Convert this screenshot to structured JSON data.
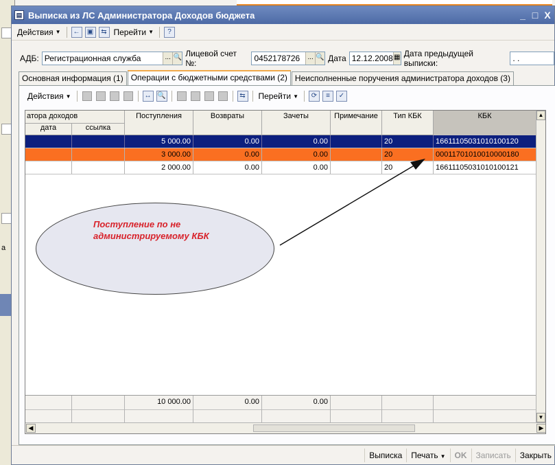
{
  "window": {
    "title": "Выписка из ЛС Администратора Доходов бюджета",
    "controls": {
      "minimize": "_",
      "maximize": "□",
      "close": "X"
    }
  },
  "toolbar": {
    "actions_label": "Действия",
    "goto_label": "Перейти",
    "help_label": "?"
  },
  "form": {
    "adb_label": "АДБ:",
    "adb_value": "Регистрационная служба",
    "account_label": "Лицевой счет №:",
    "account_value": "0452178726",
    "date_label": "Дата",
    "date_value": "12.12.2008",
    "prev_date_label": "Дата предыдущей выписки:",
    "prev_date_value": ". ."
  },
  "tabs": [
    {
      "label": "Основная информация (1)"
    },
    {
      "label": "Операции с бюджетными средствами (2)"
    },
    {
      "label": "Неисполненные поручения администратора доходов (3)"
    }
  ],
  "grid_toolbar": {
    "actions_label": "Действия",
    "goto_label": "Перейти"
  },
  "grid": {
    "headers": {
      "admin_docs": "атора доходов",
      "date": "дата",
      "link": "ссылка",
      "receipts": "Поступления",
      "returns": "Возвраты",
      "offsets": "Зачеты",
      "note": "Примечание",
      "kbk_type": "Тип КБК",
      "kbk": "КБК"
    },
    "rows": [
      {
        "date": "",
        "link": "",
        "receipts": "5 000.00",
        "returns": "0.00",
        "offsets": "0.00",
        "note": "",
        "kbk_type": "20",
        "kbk": "16611105031010100120"
      },
      {
        "date": "",
        "link": "",
        "receipts": "3 000.00",
        "returns": "0.00",
        "offsets": "0.00",
        "note": "",
        "kbk_type": "20",
        "kbk": "00011701010010000180"
      },
      {
        "date": "",
        "link": "",
        "receipts": "2 000.00",
        "returns": "0.00",
        "offsets": "0.00",
        "note": "",
        "kbk_type": "20",
        "kbk": "16611105031010100121"
      }
    ],
    "totals": {
      "receipts": "10 000.00",
      "returns": "0.00",
      "offsets": "0.00"
    }
  },
  "annotation": {
    "text": "Поступление по не администрируемому КБК"
  },
  "bottom_buttons": {
    "statement": "Выписка",
    "print": "Печать",
    "ok": "OK",
    "save": "Записать",
    "close": "Закрыть"
  },
  "colors": {
    "selected_row": "#0c1f7e",
    "highlight_row": "#fa6f21",
    "annotation_text": "#d8222a",
    "title_bar": "#5676b2"
  }
}
